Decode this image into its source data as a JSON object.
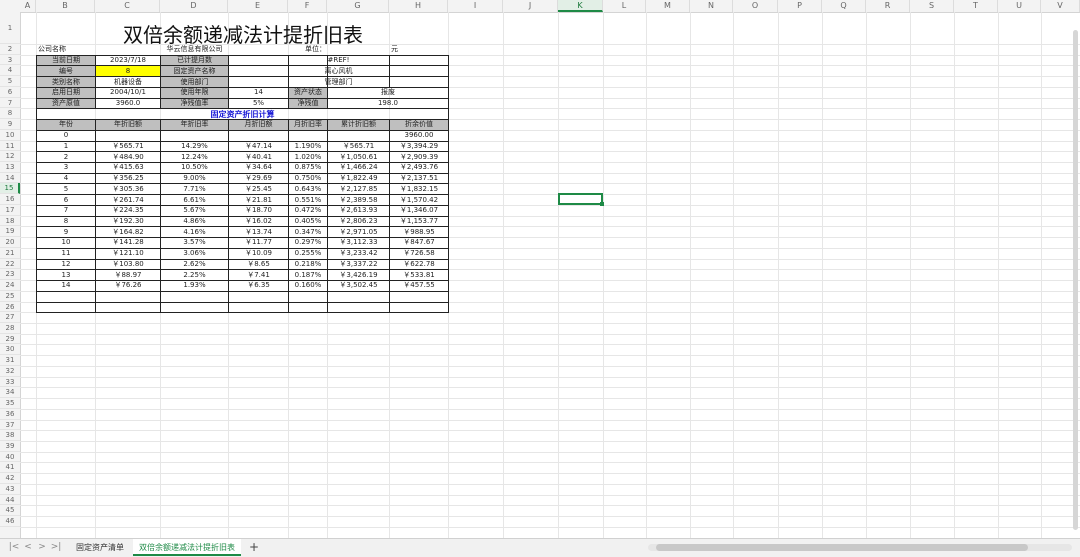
{
  "columns": [
    "A",
    "B",
    "C",
    "D",
    "E",
    "F",
    "G",
    "H",
    "I",
    "J",
    "K",
    "L",
    "M",
    "N",
    "O",
    "P",
    "Q",
    "R",
    "S",
    "T",
    "U",
    "V"
  ],
  "selected_column": "K",
  "row_count": 46,
  "selected_row": "15",
  "title": "双倍余额递减法计提折旧表",
  "header_rows": [
    [
      {
        "col": "B",
        "text": "公司名称",
        "cls": "l"
      },
      {
        "col": "D",
        "text": "华云信息有限公司",
        "cls": "c"
      },
      {
        "col": "F",
        "text": "单位：",
        "cls": "r"
      },
      {
        "col": "H",
        "text": "元",
        "cls": "l"
      }
    ],
    [
      {
        "col": "B",
        "text": "当前日期",
        "cls": "c gray"
      },
      {
        "col": "C",
        "text": "2023/7/18",
        "cls": "c"
      },
      {
        "col": "D",
        "text": "已计提月数",
        "cls": "c gray"
      },
      {
        "col": "EH",
        "text": "#REF!",
        "cls": "c"
      }
    ],
    [
      {
        "col": "B",
        "text": "编号",
        "cls": "c gray"
      },
      {
        "col": "C",
        "text": "8",
        "cls": "c yellow"
      },
      {
        "col": "D",
        "text": "固定资产名称",
        "cls": "c gray"
      },
      {
        "col": "EH",
        "text": "离心风机",
        "cls": "c"
      }
    ],
    [
      {
        "col": "B",
        "text": "类别名称",
        "cls": "c gray"
      },
      {
        "col": "C",
        "text": "机器设备",
        "cls": "c"
      },
      {
        "col": "D",
        "text": "使用部门",
        "cls": "c gray"
      },
      {
        "col": "EH",
        "text": "管理部门",
        "cls": "c"
      }
    ],
    [
      {
        "col": "B",
        "text": "启用日期",
        "cls": "c gray"
      },
      {
        "col": "C",
        "text": "2004/10/1",
        "cls": "c"
      },
      {
        "col": "D",
        "text": "使用年限",
        "cls": "c gray"
      },
      {
        "col": "E",
        "text": "14",
        "cls": "c"
      },
      {
        "col": "F",
        "text": "资产状态",
        "cls": "c gray"
      },
      {
        "col": "GH",
        "text": "报废",
        "cls": "c"
      }
    ],
    [
      {
        "col": "B",
        "text": "资产原值",
        "cls": "c gray"
      },
      {
        "col": "C",
        "text": "3960.0",
        "cls": "c"
      },
      {
        "col": "D",
        "text": "净残值率",
        "cls": "c gray"
      },
      {
        "col": "E",
        "text": "5%",
        "cls": "c"
      },
      {
        "col": "F",
        "text": "净残值",
        "cls": "c gray"
      },
      {
        "col": "GH",
        "text": "198.0",
        "cls": "c"
      }
    ]
  ],
  "section_title": "固定资产折旧计算",
  "table_headers": [
    "年份",
    "年折旧额",
    "年折旧率",
    "月折旧额",
    "月折旧率",
    "累计折旧额",
    "折余价值"
  ],
  "table_rows": [
    [
      "0",
      "",
      "",
      "",
      "",
      "",
      "3960.00"
    ],
    [
      "1",
      "￥565.71",
      "14.29%",
      "￥47.14",
      "1.190%",
      "￥565.71",
      "￥3,394.29"
    ],
    [
      "2",
      "￥484.90",
      "12.24%",
      "￥40.41",
      "1.020%",
      "￥1,050.61",
      "￥2,909.39"
    ],
    [
      "3",
      "￥415.63",
      "10.50%",
      "￥34.64",
      "0.875%",
      "￥1,466.24",
      "￥2,493.76"
    ],
    [
      "4",
      "￥356.25",
      "9.00%",
      "￥29.69",
      "0.750%",
      "￥1,822.49",
      "￥2,137.51"
    ],
    [
      "5",
      "￥305.36",
      "7.71%",
      "￥25.45",
      "0.643%",
      "￥2,127.85",
      "￥1,832.15"
    ],
    [
      "6",
      "￥261.74",
      "6.61%",
      "￥21.81",
      "0.551%",
      "￥2,389.58",
      "￥1,570.42"
    ],
    [
      "7",
      "￥224.35",
      "5.67%",
      "￥18.70",
      "0.472%",
      "￥2,613.93",
      "￥1,346.07"
    ],
    [
      "8",
      "￥192.30",
      "4.86%",
      "￥16.02",
      "0.405%",
      "￥2,806.23",
      "￥1,153.77"
    ],
    [
      "9",
      "￥164.82",
      "4.16%",
      "￥13.74",
      "0.347%",
      "￥2,971.05",
      "￥988.95"
    ],
    [
      "10",
      "￥141.28",
      "3.57%",
      "￥11.77",
      "0.297%",
      "￥3,112.33",
      "￥847.67"
    ],
    [
      "11",
      "￥121.10",
      "3.06%",
      "￥10.09",
      "0.255%",
      "￥3,233.42",
      "￥726.58"
    ],
    [
      "12",
      "￥103.80",
      "2.62%",
      "￥8.65",
      "0.218%",
      "￥3,337.22",
      "￥622.78"
    ],
    [
      "13",
      "￥88.97",
      "2.25%",
      "￥7.41",
      "0.187%",
      "￥3,426.19",
      "￥533.81"
    ],
    [
      "14",
      "￥76.26",
      "1.93%",
      "￥6.35",
      "0.160%",
      "￥3,502.45",
      "￥457.55"
    ],
    [
      "",
      "",
      "",
      "",
      "",
      "",
      ""
    ],
    [
      "",
      "",
      "",
      "",
      "",
      "",
      ""
    ]
  ],
  "sheet_tabs": [
    {
      "label": "固定资产清单",
      "active": false
    },
    {
      "label": "双倍余额递减法计提折旧表",
      "active": true
    }
  ],
  "nav_buttons": [
    "|<",
    "<",
    ">",
    ">|"
  ],
  "add_tab": "+",
  "colors": {
    "accent": "#1e8a46",
    "header_fill": "#bfbfbf",
    "highlight": "#ffff00",
    "section_title": "#1a1ad6"
  }
}
